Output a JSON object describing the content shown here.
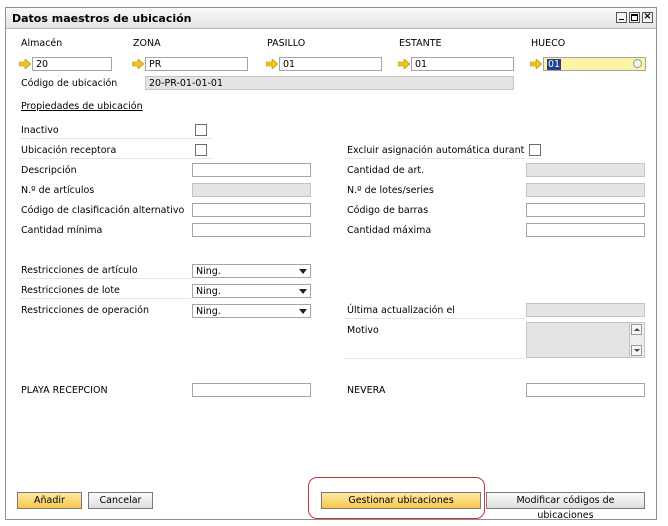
{
  "window": {
    "title": "Datos maestros de ubicación"
  },
  "header": {
    "fields": [
      {
        "label": "Almacén",
        "value": "20"
      },
      {
        "label": "ZONA",
        "value": "PR"
      },
      {
        "label": "PASILLO",
        "value": "01"
      },
      {
        "label": "ESTANTE",
        "value": "01"
      },
      {
        "label": "HUECO",
        "value": "01"
      }
    ],
    "code_label": "Código de ubicación",
    "code_value": "20-PR-01-01-01"
  },
  "section_title": "Propiedades de ubicación",
  "left": {
    "inactive": "Inactivo",
    "receiving": "Ubicación receptora",
    "description": "Descripción",
    "num_items": "N.º de artículos",
    "alt_sort_code": "Código de clasificación alternativo",
    "min_qty": "Cantidad mínima",
    "item_restrictions": "Restricciones de artículo",
    "item_restrictions_value": "Ning.",
    "batch_restrictions": "Restricciones de lote",
    "batch_restrictions_value": "Ning.",
    "operation_restrictions": "Restricciones de operación",
    "operation_restrictions_value": "Ning.",
    "udf1": "PLAYA RECEPCION"
  },
  "right": {
    "exclude_auto": "Excluir asignación automática durante ei",
    "item_qty": "Cantidad de art.",
    "num_batches": "N.º de lotes/series",
    "barcode": "Código de barras",
    "max_qty": "Cantidad máxima",
    "last_update": "Última actualización el",
    "reason": "Motivo",
    "udf2": "NEVERA"
  },
  "buttons": {
    "add": "Añadir",
    "cancel": "Cancelar",
    "manage": "Gestionar ubicaciones",
    "modify": "Modificar códigos de ubicaciones"
  }
}
